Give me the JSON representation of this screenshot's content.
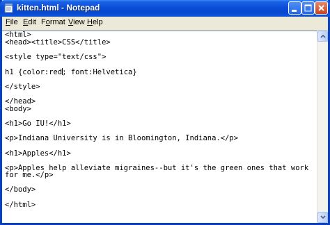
{
  "window": {
    "title": "kitten.html - Notepad"
  },
  "menu": {
    "items": [
      {
        "accel": "F",
        "rest": "ile"
      },
      {
        "accel": "E",
        "rest": "dit"
      },
      {
        "accel": "F",
        "rest": "ormat",
        "full": "Format",
        "accel_index": 1
      },
      {
        "accel": "V",
        "rest": "iew"
      },
      {
        "accel": "H",
        "rest": "elp"
      }
    ]
  },
  "editor": {
    "lines": [
      "<html>",
      "<head><title>CSS</title>",
      "",
      "<style type=\"text/css\">",
      "",
      "h1 {color:red; font:Helvetica}",
      "",
      "</style>",
      "",
      "</head>",
      "<body>",
      "",
      "<h1>Go IU!</h1>",
      "",
      "<p>Indiana University is in Bloomington, Indiana.</p>",
      "",
      "<h1>Apples</h1>",
      "",
      "<p>Apples help alleviate migraines--but it's the green ones that work",
      "for me.</p>",
      "",
      "</body>",
      "",
      "</html>"
    ],
    "caret_line": 5,
    "caret_col": 13
  },
  "icons": {
    "app": "notepad-icon",
    "minimize": "minimize-icon",
    "maximize": "maximize-icon",
    "close": "close-icon",
    "scroll_up": "arrow-up-icon",
    "scroll_down": "arrow-down-icon"
  }
}
